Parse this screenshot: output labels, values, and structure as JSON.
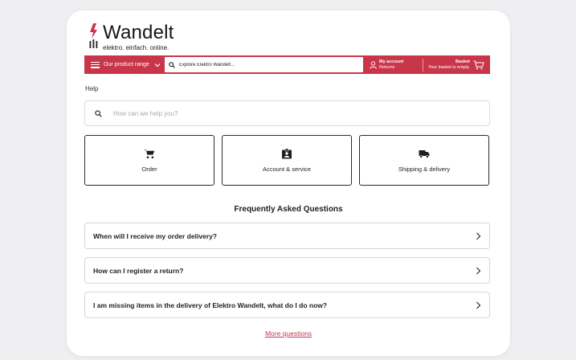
{
  "brand": {
    "name": "Wandelt",
    "tagline": "elektro. einfach. online.",
    "accent": "#c9364a"
  },
  "navbar": {
    "range_label": "Our product range",
    "search_placeholder": "Explore Elektro Wandelt...",
    "account_title": "My account",
    "account_sub": "Returns",
    "basket_title": "Basket",
    "basket_sub": "Your basket is empty.",
    "icons": [
      "hamburger-icon",
      "chevron-down-icon",
      "search-icon",
      "user-icon",
      "cart-icon"
    ]
  },
  "help": {
    "label": "Help",
    "search_placeholder": "How can we help you?"
  },
  "tiles": [
    {
      "label": "Order",
      "icon": "cart-icon"
    },
    {
      "label": "Account & service",
      "icon": "account-badge-icon"
    },
    {
      "label": "Shipping & delivery",
      "icon": "truck-icon"
    }
  ],
  "faq": {
    "title": "Frequently Asked Questions",
    "items": [
      {
        "question": "When will I receive my order delivery?"
      },
      {
        "question": "How can I register a return?"
      },
      {
        "question": "I am missing items in the delivery of Elektro Wandelt, what do I do now?"
      }
    ],
    "more_label": "More questions"
  }
}
